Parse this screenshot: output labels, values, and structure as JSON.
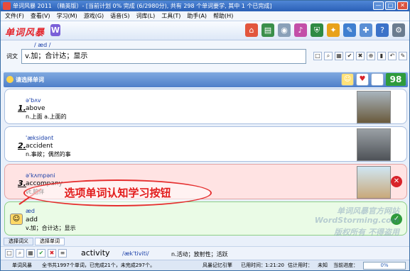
{
  "window": {
    "title": "单词风暴 2011 （精英版）- [当前计划 0% 完成 (6/2980分), 共有 298 个单词要学, 其中 1 个已完成]",
    "minimize": "—",
    "maximize": "□",
    "close": "✕"
  },
  "menu": [
    "文件(F)",
    "查看(V)",
    "学习(M)",
    "游戏(G)",
    "语音(S)",
    "词库(L)",
    "工具(T)",
    "助手(A)",
    "帮助(H)"
  ],
  "toolbar": {
    "logo": "单词风暴",
    "logo_w": "W",
    "icons": [
      {
        "name": "home-icon",
        "glyph": "⌂",
        "color": "#e2563d"
      },
      {
        "name": "book-icon",
        "glyph": "▤",
        "color": "#3a8f4a"
      },
      {
        "name": "disc-icon",
        "glyph": "◉",
        "color": "#8aa0b8"
      },
      {
        "name": "music-icon",
        "glyph": "♪",
        "color": "#c34fa8"
      },
      {
        "name": "shield-icon",
        "glyph": "⛨",
        "color": "#2f8a43"
      },
      {
        "name": "run-icon",
        "glyph": "✦",
        "color": "#e8a21b"
      },
      {
        "name": "tools-icon",
        "glyph": "✎",
        "color": "#3f7fd0"
      },
      {
        "name": "puzzle-icon",
        "glyph": "✚",
        "color": "#5a8fd5"
      },
      {
        "name": "help-icon",
        "glyph": "?",
        "color": "#3b72c9"
      },
      {
        "name": "gear-icon",
        "glyph": "⚙",
        "color": "#6b7c8f"
      }
    ]
  },
  "input": {
    "phonetic": "/ æd /",
    "label": "词文",
    "value": "v.加；合计达；显示",
    "tools": [
      "□",
      "⌕",
      "▦",
      "✔",
      "✖",
      "⊕",
      "▮",
      "↶",
      "✎"
    ]
  },
  "section": {
    "title": "请选择单词",
    "score": "98"
  },
  "cards": [
    {
      "num": "1.",
      "phonetic": "ə'bʌv",
      "word": "above",
      "meaning": "n.上面  a.上面的",
      "bg": "#ffffff",
      "status": ""
    },
    {
      "num": "2.",
      "phonetic": "'æksidənt",
      "word": "accident",
      "meaning": "n.事故；偶然的事",
      "bg": "#ffffff",
      "status": ""
    },
    {
      "num": "3.",
      "phonetic": "ə'kʌmpəni",
      "word": "accompany",
      "meaning": "vt.陪伴",
      "bg": "#ffe3e3",
      "status": "✕"
    },
    {
      "num": "",
      "phonetic": "æd",
      "word": "add",
      "meaning": "v.加；合计达；显示",
      "bg": "#eafbe6",
      "status": "✓"
    }
  ],
  "callout": "选项单词认知学习按钮",
  "watermark": [
    "单词风暴官方网站",
    "WordStorming.com",
    "版权所有 不得盗用"
  ],
  "lower_tabs": [
    "选择词义",
    "选择单词"
  ],
  "bottom": {
    "word": "activity",
    "phonetic": "/æk'tiviti/",
    "meaning": "n.活动；放射性；活跃"
  },
  "status": {
    "app": "单词风暴",
    "summary": "全书共1997个单词，已完成21个，未完成297个。",
    "engine": "风暴记忆引擎",
    "used_label": "已用时间：",
    "used": "1:21:20",
    "est_label": "估计用时：",
    "est": "未知",
    "progress_label": "当前进度：",
    "progress": "0%"
  }
}
